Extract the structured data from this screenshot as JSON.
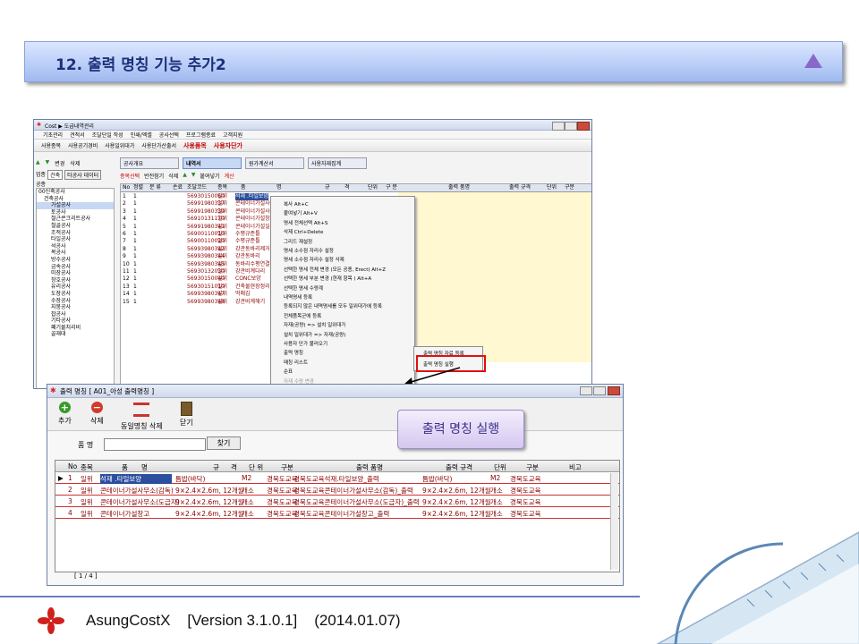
{
  "banner": {
    "title": "12. 출력 명칭 기능 추가2"
  },
  "main_window": {
    "title": "Cost  ▶ 도급내역관리",
    "menu": [
      "기초관리",
      "견적서",
      "조달단일 작성",
      "인쇄/엑셀",
      "공사선택",
      "프로그램종료",
      "고객지원"
    ],
    "toolbar": [
      "사용종목",
      "사용공기경비",
      "사용일위대가",
      "사용단가산출서",
      "사용품목",
      "사용자단가"
    ],
    "tabs": [
      "공사개요",
      "내역서",
      "원가계산서",
      "사용자재집계"
    ],
    "subtoolbar": [
      "변경",
      "삭제"
    ],
    "grid_toolbar": [
      "종목선택",
      "반전참기",
      "삭제",
      "붙여넣기",
      "계산"
    ],
    "filter_label": "업종",
    "filter_value": "건축",
    "filter_btn": "타공사 데이터",
    "search_label": "공종",
    "tree": [
      "00신축공사",
      "건축공사",
      "가설공사",
      "토공사",
      "철근콘크리트공사",
      "철골공사",
      "조적공사",
      "타일공사",
      "석공사",
      "목공사",
      "방수공사",
      "금속공사",
      "미장공사",
      "창호공사",
      "유리공사",
      "도장공사",
      "수장공사",
      "지붕공사",
      "잡공사",
      "기타공사",
      "폐기물처리비",
      "골재대"
    ],
    "grid_headers": [
      "No",
      "정렬",
      "분 류",
      "손료",
      "조달코드",
      "종목",
      "품",
      "명",
      "규",
      "격",
      "단위",
      "구 분",
      "출력 품명",
      "출력 규격",
      "단위",
      "구분"
    ],
    "grid_rows": [
      {
        "no": "1",
        "sort": "1",
        "code": "56930150060",
        "kind": "일위",
        "name": "석재 .타일보양"
      },
      {
        "no": "2",
        "sort": "1",
        "code": "56991980337",
        "kind": "일위",
        "name": "콘테이너가설사무소"
      },
      {
        "no": "3",
        "sort": "1",
        "code": "56991980339",
        "kind": "일위",
        "name": "콘테이너가설사무소"
      },
      {
        "no": "4",
        "sort": "1",
        "code": "56910131170",
        "kind": "일위",
        "name": "콘테이너가설창고"
      },
      {
        "no": "5",
        "sort": "1",
        "code": "56991980341",
        "kind": "일위",
        "name": "콘테이너가설실험실"
      },
      {
        "no": "6",
        "sort": "1",
        "code": "56900110010",
        "kind": "일위",
        "name": "수평규준틀"
      },
      {
        "no": "7",
        "sort": "1",
        "code": "56900110020",
        "kind": "일위",
        "name": "수평규준틀"
      },
      {
        "no": "8",
        "sort": "1",
        "code": "56993980342",
        "kind": "일위",
        "name": "강관동바리제거"
      },
      {
        "no": "9",
        "sort": "1",
        "code": "56993980344",
        "kind": "일위",
        "name": "강관동바리"
      },
      {
        "no": "10",
        "sort": "1",
        "code": "56993980345",
        "kind": "일위",
        "name": "동바리수평연결재"
      },
      {
        "no": "11",
        "sort": "1",
        "code": "56930132030",
        "kind": "일위",
        "name": "강관비계다리"
      },
      {
        "no": "12",
        "sort": "1",
        "code": "56930150040",
        "kind": "일위",
        "name": "CONC보양"
      },
      {
        "no": "13",
        "sort": "1",
        "code": "56930151010",
        "kind": "일위",
        "name": "건축물현장정리"
      },
      {
        "no": "14",
        "sort": "1",
        "code": "56993980347",
        "kind": "일위",
        "name": "먹매김"
      },
      {
        "no": "15",
        "sort": "1",
        "code": "56993980348",
        "kind": "일위",
        "name": "강관비계해기"
      }
    ],
    "context_menu": [
      "복사 Alt+C",
      "붙여넣기 Alt+V",
      "명세 전체선택 Alt+S",
      "삭제 Ctrl+Delete",
      "그리드 재설정",
      "명세 소수점 자리수 설정",
      "명세 소수점 자리수 설정 삭제",
      "선택한 명세 전체 변경 (모든 공종, Erect) Alt+Z",
      "선택한 명세 부분 변경 (현재 항목            ) Alt+A",
      "선택한 명세 수량계",
      "내역명세 등록",
      "등록되지 않은 내역명세를 모두 일위대가에 등록",
      "전체품목군에 등록",
      "자재(공량) => 설치 일위대가",
      "설치 일위대가 => 자재(공량)",
      "사용자 단가 불러오기",
      "출력 명칭",
      "매칭 리스트",
      "순표",
      "자재 수량 변경"
    ],
    "submenu": [
      "출력 명칭 자료 등록",
      "출력 명칭 실행"
    ]
  },
  "output_window": {
    "title": "출력 명칭  [ A01_아성 출력명칭 ]",
    "buttons": [
      "추가",
      "삭제",
      "동일명칭 삭제",
      "닫기"
    ],
    "search_label": "품  명",
    "search_value": "",
    "find_button": "찾기",
    "headers": [
      "No",
      "종목",
      "품",
      "명",
      "규",
      "격",
      "단 위",
      "구분",
      "출력 품명",
      "출력 규격",
      "단위",
      "구분",
      "비고"
    ],
    "rows": [
      {
        "no": "1",
        "kind": "일위",
        "name": "석재 .타일보양",
        "spec": "틈밥(바닥)",
        "unit": "M2",
        "cat": "경북도교육",
        "out_name": "경북도교육석재.타일보양_출력",
        "out_spec": "틈밥(바닥)",
        "out_unit": "M2",
        "out_cat": "경북도교육"
      },
      {
        "no": "2",
        "kind": "일위",
        "name": "콘테이너가설사무소(감독)",
        "spec": "9×2.4×2.6m, 12개월",
        "unit": "개소",
        "cat": "경북도교육",
        "out_name": "경북도교육콘테이너가설사무소(감독)_출력",
        "out_spec": "9×2.4×2.6m, 12개월",
        "out_unit": "개소",
        "out_cat": "경북도교육"
      },
      {
        "no": "3",
        "kind": "일위",
        "name": "콘테이너가설사무소(도급자)",
        "spec": "9×2.4×2.6m, 12개월",
        "unit": "개소",
        "cat": "경북도교육",
        "out_name": "경북도교육콘테이너가설사무소(도급자)_출력",
        "out_spec": "9×2.4×2.6m, 12개월",
        "out_unit": "개소",
        "out_cat": "경북도교육"
      },
      {
        "no": "4",
        "kind": "일위",
        "name": "콘테이너가설창고",
        "spec": "9×2.4×2.6m, 12개월",
        "unit": "개소",
        "cat": "경북도교육",
        "out_name": "경북도교육콘테이너가설창고_출력",
        "out_spec": "9×2.4×2.6m, 12개월",
        "out_unit": "개소",
        "out_cat": "경북도교육"
      }
    ],
    "pager": "[  1 / 4  ]"
  },
  "callout": "출력 명칭 실행",
  "footer": {
    "app": "AsungCostX",
    "version": "[Version 3.1.0.1]",
    "date": "(2014.01.07)"
  },
  "colors": {
    "accent": "#1f2f7a",
    "row_text": "#8b0000",
    "highlight": "#e01010"
  }
}
